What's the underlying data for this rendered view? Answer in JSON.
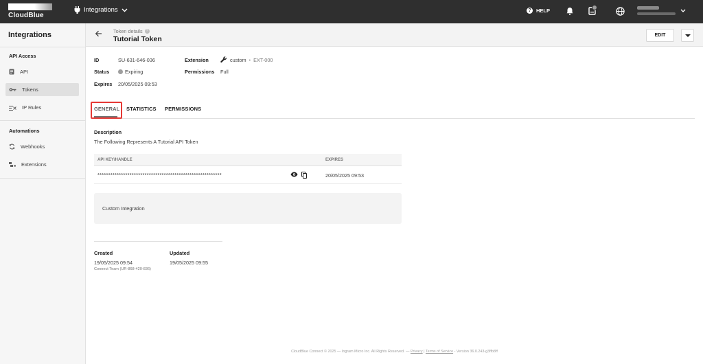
{
  "topbar": {
    "logo_text": "CloudBlue",
    "module": "Integrations",
    "help": "HELP"
  },
  "sidebar": {
    "title": "Integrations",
    "sections": [
      {
        "label": "API Access",
        "items": [
          {
            "label": "API",
            "icon": "document-icon"
          },
          {
            "label": "Tokens",
            "icon": "key-icon",
            "active": true
          },
          {
            "label": "IP Rules",
            "icon": "filter-icon"
          }
        ]
      },
      {
        "label": "Automations",
        "items": [
          {
            "label": "Webhooks",
            "icon": "sync-icon"
          },
          {
            "label": "Extensions",
            "icon": "extension-icon"
          }
        ]
      }
    ]
  },
  "header": {
    "breadcrumb": "Token details",
    "title": "Tutorial Token",
    "edit": "EDIT"
  },
  "details": {
    "id_label": "ID",
    "id": "SU-631-646-036",
    "status_label": "Status",
    "status": "Expiring",
    "expires_label": "Expires",
    "expires": "20/05/2025 09:53",
    "extension_label": "Extension",
    "extension": "custom",
    "extension_sep": "•",
    "extension_id": "EXT-000",
    "permissions_label": "Permissions",
    "permissions": "Full"
  },
  "tabs": [
    "GENERAL",
    "STATISTICS",
    "PERMISSIONS"
  ],
  "general": {
    "description_label": "Description",
    "description": "The Following Represents A Tutorial API Token",
    "table": {
      "columns": [
        "API KEY/HANDLE",
        "EXPIRES"
      ],
      "rows": [
        {
          "key": "**********************************************************",
          "expires": "20/05/2025 09:53"
        }
      ]
    },
    "panel_text": "Custom Integration",
    "created_label": "Created",
    "created": "19/05/2025 09:54",
    "created_by": "Connect Team (UR-868-420-836)",
    "updated_label": "Updated",
    "updated": "19/05/2025 09:55"
  },
  "footer": {
    "copyright": "CloudBlue Connect © 2025 — Ingram Micro Inc. All Rights Reserved. — ",
    "privacy": "Privacy",
    "sep": " | ",
    "terms": "Terms of Service",
    "version": " - Version 36.0.243-g3ffb8ff"
  }
}
